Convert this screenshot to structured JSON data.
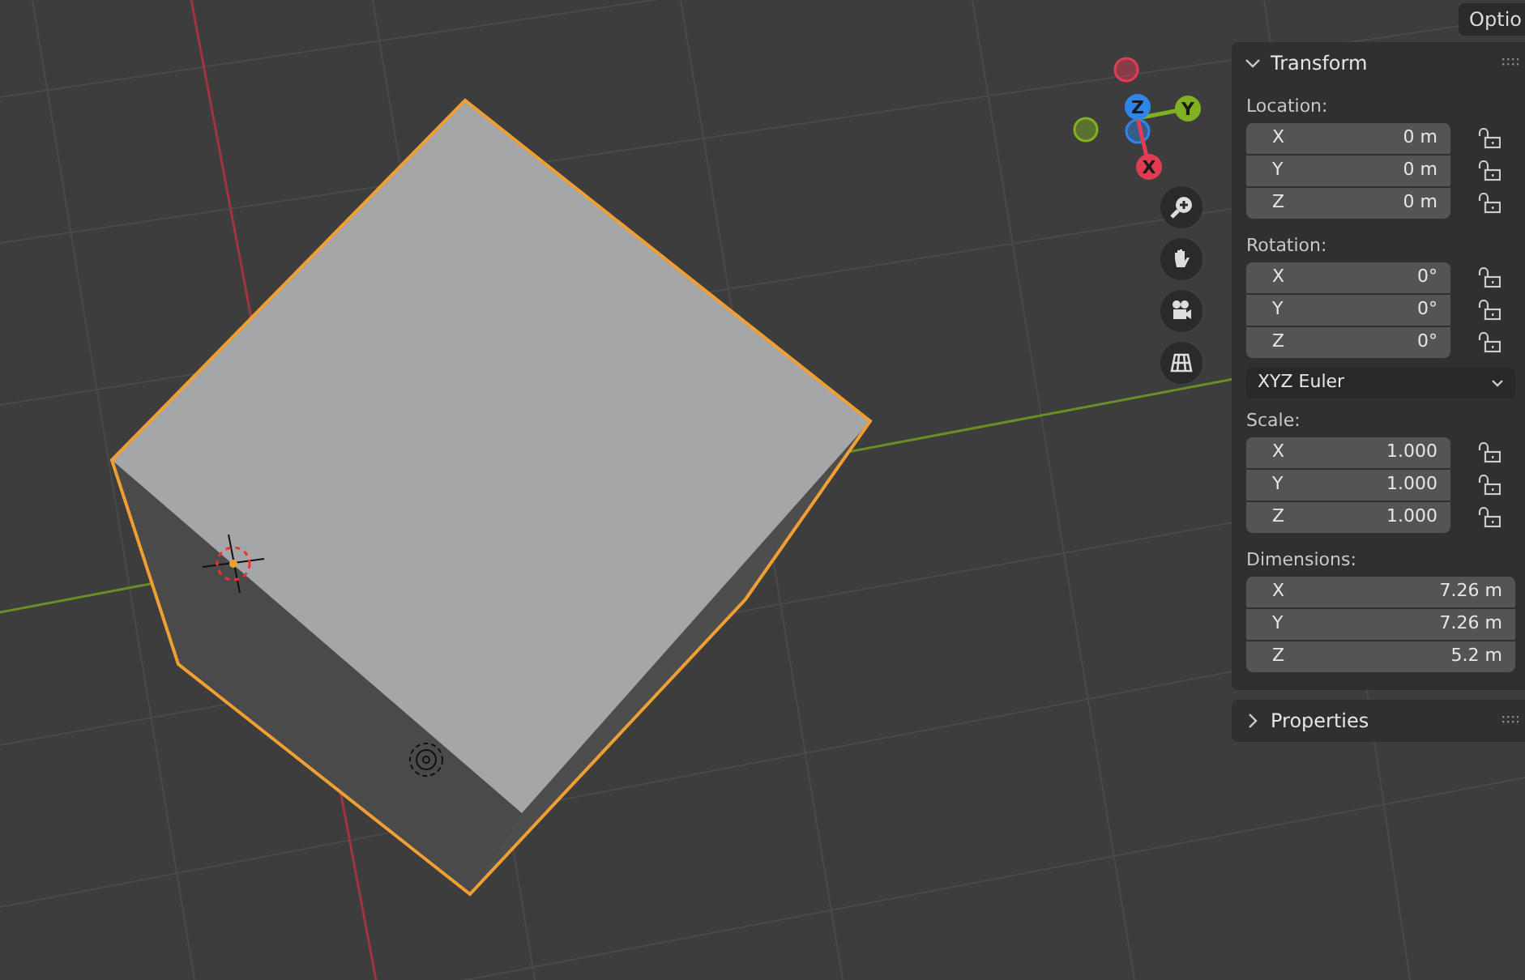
{
  "options_button": "Optio",
  "gizmo": {
    "axes": [
      {
        "label": "X",
        "color": "#e23c55"
      },
      {
        "label": "Y",
        "color": "#7fb122"
      },
      {
        "label": "Z",
        "color": "#2f86e8"
      }
    ]
  },
  "transform_panel": {
    "title": "Transform",
    "expanded": true,
    "sections": [
      {
        "kind": "fields",
        "label": "Location:",
        "rows": [
          {
            "axis": "X",
            "value": "0 m",
            "locked": false
          },
          {
            "axis": "Y",
            "value": "0 m",
            "locked": false
          },
          {
            "axis": "Z",
            "value": "0 m",
            "locked": false
          }
        ]
      },
      {
        "kind": "fields",
        "label": "Rotation:",
        "rows": [
          {
            "axis": "X",
            "value": "0°",
            "locked": false
          },
          {
            "axis": "Y",
            "value": "0°",
            "locked": false
          },
          {
            "axis": "Z",
            "value": "0°",
            "locked": false
          }
        ]
      },
      {
        "kind": "dropdown",
        "value": "XYZ Euler"
      },
      {
        "kind": "fields",
        "label": "Scale:",
        "rows": [
          {
            "axis": "X",
            "value": "1.000",
            "locked": false
          },
          {
            "axis": "Y",
            "value": "1.000",
            "locked": false
          },
          {
            "axis": "Z",
            "value": "1.000",
            "locked": false
          }
        ]
      },
      {
        "kind": "fields",
        "label": "Dimensions:",
        "rows": [
          {
            "axis": "X",
            "value": "7.26 m"
          },
          {
            "axis": "Y",
            "value": "7.26 m"
          },
          {
            "axis": "Z",
            "value": "5.2 m"
          }
        ]
      }
    ]
  },
  "properties_panel": {
    "title": "Properties",
    "expanded": false
  }
}
